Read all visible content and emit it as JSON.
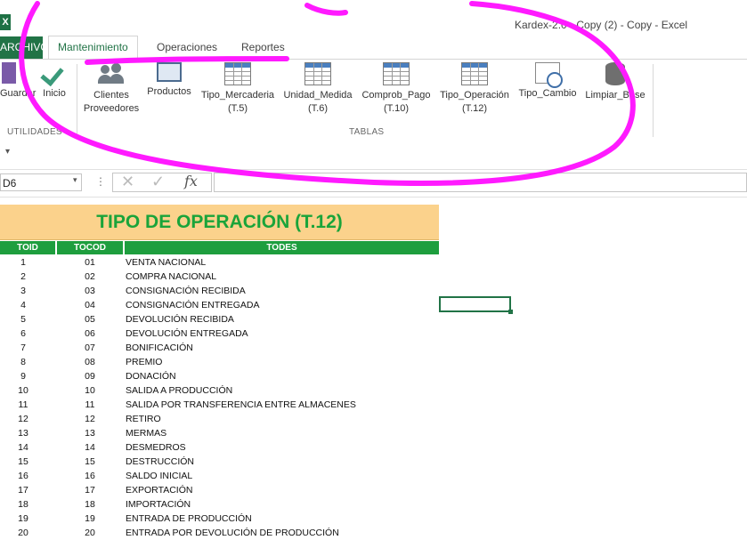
{
  "window": {
    "title": "Kardex-2.0 - Copy (2) - Copy - Excel",
    "logo_text": "X"
  },
  "tabs": {
    "file": "ARCHIVO",
    "items": [
      "Mantenimiento",
      "Operaciones",
      "Reportes"
    ],
    "active": "Mantenimiento"
  },
  "ribbon": {
    "utilidades": {
      "label": "UTILIDADES",
      "buttons": [
        "Guardar",
        "Inicio"
      ]
    },
    "tablas": {
      "label": "TABLAS",
      "buttons": [
        {
          "line1": "Clientes",
          "line2": "Proveedores"
        },
        {
          "line1": "Productos",
          "line2": ""
        },
        {
          "line1": "Tipo_Mercaderia",
          "line2": "(T.5)"
        },
        {
          "line1": "Unidad_Medida",
          "line2": "(T.6)"
        },
        {
          "line1": "Comprob_Pago",
          "line2": "(T.10)"
        },
        {
          "line1": "Tipo_Operación",
          "line2": "(T.12)"
        },
        {
          "line1": "Tipo_Cambio",
          "line2": ""
        },
        {
          "line1": "Limpiar_Base",
          "line2": ""
        }
      ]
    }
  },
  "qat": {
    "arrow": "▾"
  },
  "formula_bar": {
    "namebox": "D6",
    "namebox_arrow": "▾",
    "dots": "⋮",
    "cancel": "✕",
    "enter": "✓",
    "fx": "fx",
    "value": ""
  },
  "sheet": {
    "title": "TIPO DE OPERACIÓN (T.12)",
    "headers": [
      "TOID",
      "TOCOD",
      "TODES"
    ],
    "rows": [
      [
        "1",
        "01",
        "VENTA NACIONAL"
      ],
      [
        "2",
        "02",
        "COMPRA NACIONAL"
      ],
      [
        "3",
        "03",
        "CONSIGNACIÓN RECIBIDA"
      ],
      [
        "4",
        "04",
        "CONSIGNACIÓN ENTREGADA"
      ],
      [
        "5",
        "05",
        "DEVOLUCIÓN RECIBIDA"
      ],
      [
        "6",
        "06",
        "DEVOLUCIÓN ENTREGADA"
      ],
      [
        "7",
        "07",
        "BONIFICACIÓN"
      ],
      [
        "8",
        "08",
        "PREMIO"
      ],
      [
        "9",
        "09",
        "DONACIÓN"
      ],
      [
        "10",
        "10",
        "SALIDA A PRODUCCIÓN"
      ],
      [
        "11",
        "11",
        "SALIDA POR TRANSFERENCIA ENTRE ALMACENES"
      ],
      [
        "12",
        "12",
        "RETIRO"
      ],
      [
        "13",
        "13",
        "MERMAS"
      ],
      [
        "14",
        "14",
        "DESMEDROS"
      ],
      [
        "15",
        "15",
        "DESTRUCCIÓN"
      ],
      [
        "16",
        "16",
        "SALDO INICIAL"
      ],
      [
        "17",
        "17",
        "EXPORTACIÓN"
      ],
      [
        "18",
        "18",
        "IMPORTACIÓN"
      ],
      [
        "19",
        "19",
        "ENTRADA DE PRODUCCIÓN"
      ],
      [
        "20",
        "20",
        "ENTRADA POR DEVOLUCIÓN DE PRODUCCIÓN"
      ]
    ]
  },
  "colors": {
    "excel_green": "#217346",
    "header_green": "#1e9e3e",
    "title_bg": "#fbd28c",
    "annotation": "#ff1aff"
  }
}
